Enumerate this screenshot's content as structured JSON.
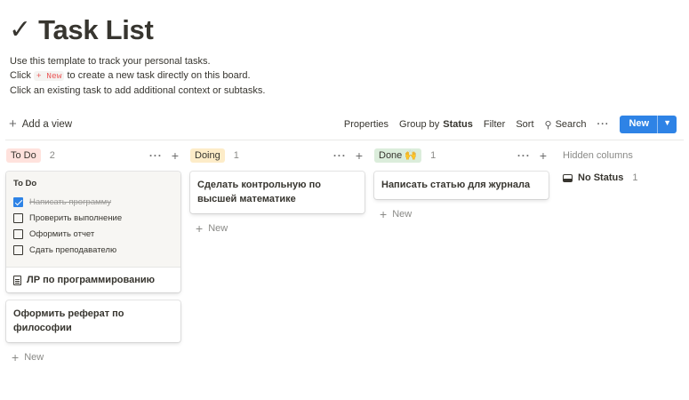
{
  "page": {
    "title_icon": "✓",
    "title": "Task List",
    "desc_line1": "Use this template to track your personal tasks.",
    "desc_line2_pre": "Click",
    "desc_line2_code": "+ New",
    "desc_line2_post": "to create a new task directly on this board.",
    "desc_line3": "Click an existing task to add additional context or subtasks."
  },
  "toolbar": {
    "add_view": "Add a view",
    "properties": "Properties",
    "group_by_label": "Group by",
    "group_by_value": "Status",
    "filter": "Filter",
    "sort": "Sort",
    "search": "Search",
    "more": "···",
    "new": "New"
  },
  "columns": [
    {
      "name": "To Do",
      "count": "2",
      "color": "#ffe2dd",
      "cards": [
        {
          "preview_title": "To Do",
          "items": [
            {
              "text": "Написать программу",
              "checked": true
            },
            {
              "text": "Проверить выполнение",
              "checked": false
            },
            {
              "text": "Оформить отчет",
              "checked": false
            },
            {
              "text": "Сдать преподавателю",
              "checked": false
            }
          ],
          "title": "ЛР по программированию"
        },
        {
          "title": "Оформить реферат по  философии"
        }
      ],
      "add_label": "New"
    },
    {
      "name": "Doing",
      "count": "1",
      "color": "#fdecc8",
      "cards": [
        {
          "title": "Сделать контрольную по высшей математике"
        }
      ],
      "add_label": "New"
    },
    {
      "name": "Done 🙌",
      "count": "1",
      "color": "#dbeddb",
      "cards": [
        {
          "title": "Написать статью для журнала"
        }
      ],
      "add_label": "New"
    }
  ],
  "hidden": {
    "title": "Hidden columns",
    "item_label": "No Status",
    "item_count": "1"
  },
  "colors": {
    "accent": "#2e83e6",
    "todo": "#ffe2dd",
    "doing": "#fdecc8",
    "done": "#dbeddb"
  }
}
